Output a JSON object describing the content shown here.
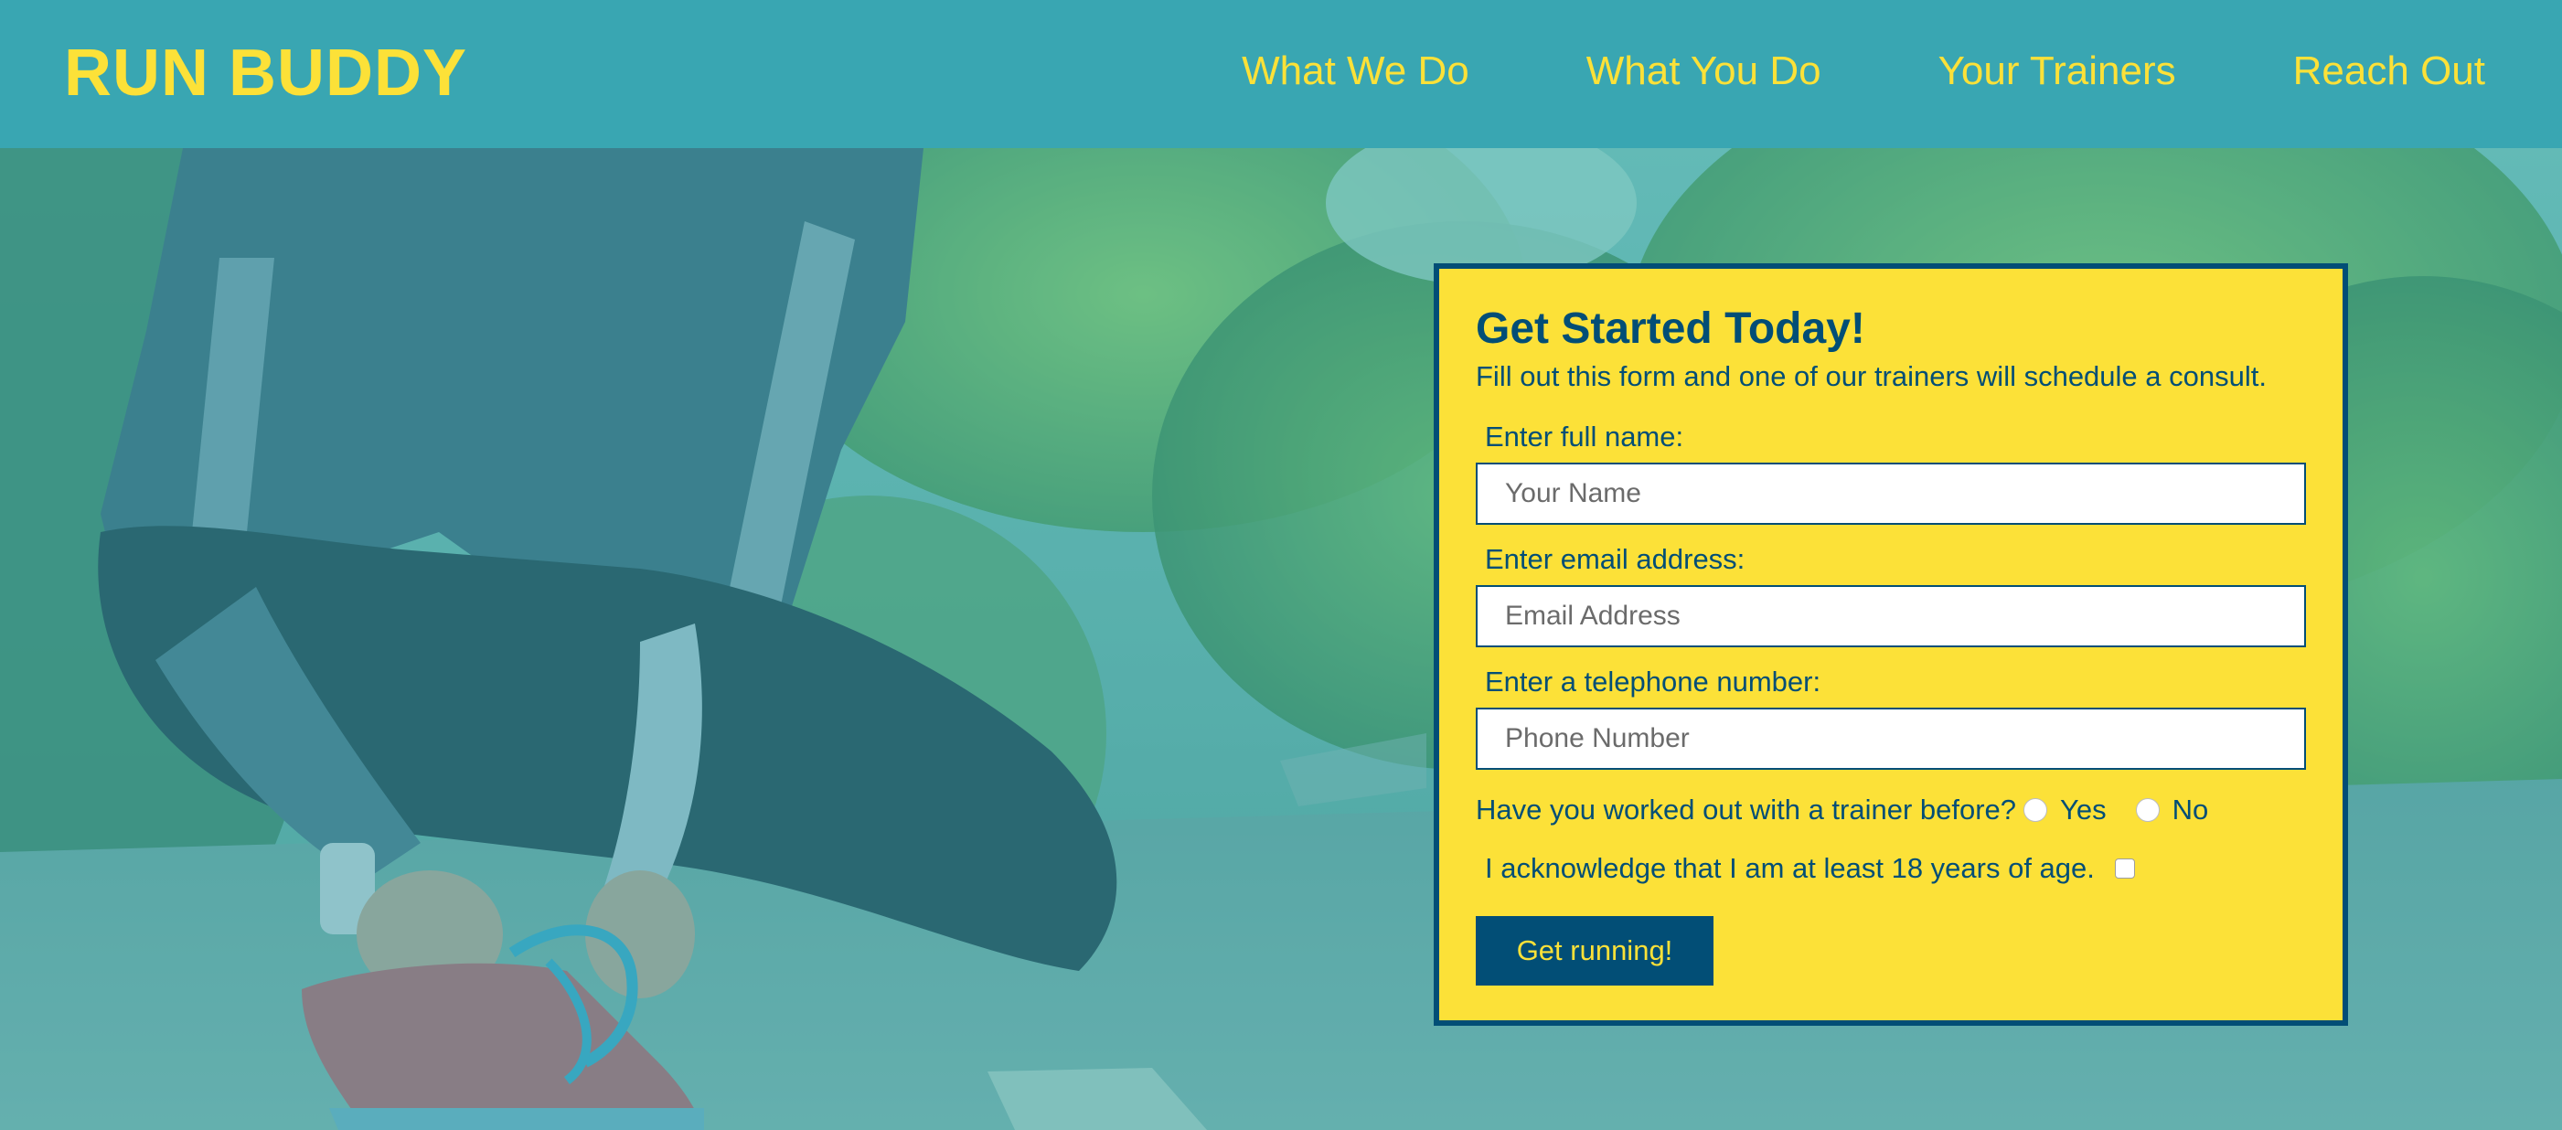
{
  "header": {
    "logo": "RUN BUDDY",
    "nav": [
      {
        "label": "What We Do"
      },
      {
        "label": "What You Do"
      },
      {
        "label": "Your Trainers"
      },
      {
        "label": "Reach Out"
      }
    ]
  },
  "form": {
    "title": "Get Started Today!",
    "subtitle": "Fill out this form and one of our trainers will schedule a consult.",
    "name_label": "Enter full name:",
    "name_placeholder": "Your Name",
    "email_label": "Enter email address:",
    "email_placeholder": "Email Address",
    "phone_label": "Enter a telephone number:",
    "phone_placeholder": "Phone Number",
    "trainer_question": "Have you worked out with a trainer before?",
    "yes_label": "Yes",
    "no_label": "No",
    "age_ack": "I acknowledge that I am at least 18 years of age.",
    "submit_label": "Get running!"
  },
  "colors": {
    "header_bg": "#39a6b2",
    "accent_yellow": "#fce138",
    "dark_blue": "#024e76"
  },
  "hero": {
    "image_description_icon": "runner-tying-shoe-photo"
  }
}
